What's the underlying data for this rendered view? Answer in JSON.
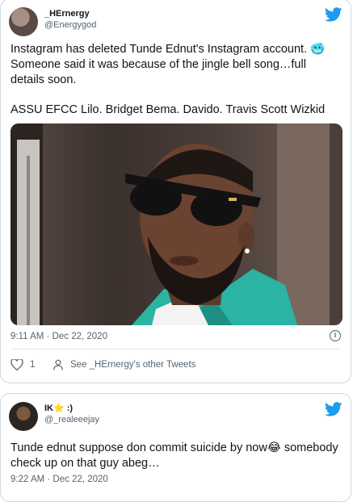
{
  "tweet1": {
    "display_name": "_HErnergy",
    "handle": "@Energygod",
    "body": "Instagram has deleted Tunde Ednut's Instagram account. 🥶 Someone said it was because of the jingle bell song…full details soon.",
    "tags": "ASSU EFCC Lilo.  Bridget Bema.  Davido.   Travis Scott  Wizkid",
    "timestamp": "9:11 AM · Dec 22, 2020",
    "like_count": "1",
    "see_other": "See _HErnergy's other Tweets"
  },
  "tweet2": {
    "display_name": "IK⭐ :)",
    "handle": "@_realeeejay",
    "body": "Tunde ednut suppose don commit suicide by now😂 somebody check up on that guy abeg…",
    "timestamp": "9:22 AM · Dec 22, 2020"
  },
  "colors": {
    "twitter_blue": "#1d9bf0",
    "teal_suit": "#2bb3a3",
    "text_secondary": "#536471"
  },
  "icons": [
    "twitter-bird-icon",
    "info-icon",
    "heart-icon",
    "person-icon"
  ]
}
